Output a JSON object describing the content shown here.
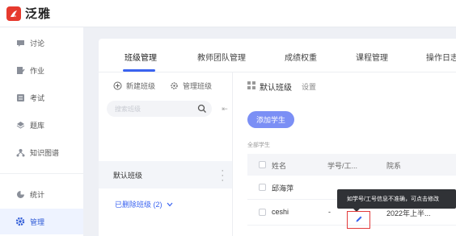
{
  "app": {
    "name": "泛雅",
    "brand_color": "#e63a2e",
    "accent_color": "#3a63f0"
  },
  "sidebar": {
    "items": [
      {
        "label": "讨论",
        "icon": "chat-bubble-icon"
      },
      {
        "label": "作业",
        "icon": "homework-icon"
      },
      {
        "label": "考试",
        "icon": "exam-icon"
      },
      {
        "label": "题库",
        "icon": "question-bank-icon"
      },
      {
        "label": "知识图谱",
        "icon": "knowledge-graph-icon"
      },
      {
        "label": "统计",
        "icon": "statistics-icon"
      },
      {
        "label": "管理",
        "icon": "gear-icon",
        "active": true
      }
    ]
  },
  "tabs": [
    {
      "label": "班级管理",
      "active": true
    },
    {
      "label": "教师团队管理"
    },
    {
      "label": "成绩权重"
    },
    {
      "label": "课程管理"
    },
    {
      "label": "操作日志"
    }
  ],
  "class_panel": {
    "create_label": "新建班级",
    "manage_label": "管理班级",
    "search_placeholder": "搜索班级",
    "class_name": "默认班级",
    "removed_label": "已删除班级 (2)"
  },
  "detail": {
    "title": "默认班级",
    "setting_label": "设置",
    "add_student_label": "添加学生",
    "all_students_label": "全部学生",
    "columns": [
      "姓名",
      "学号/工...",
      "院系"
    ],
    "rows": [
      {
        "name": "邱海萍",
        "id": "",
        "dept": ""
      },
      {
        "name": "ceshi",
        "id": "-",
        "dept": "2022年上半..."
      }
    ],
    "tooltip": "如学号/工号信息不准确，可点击修改"
  }
}
